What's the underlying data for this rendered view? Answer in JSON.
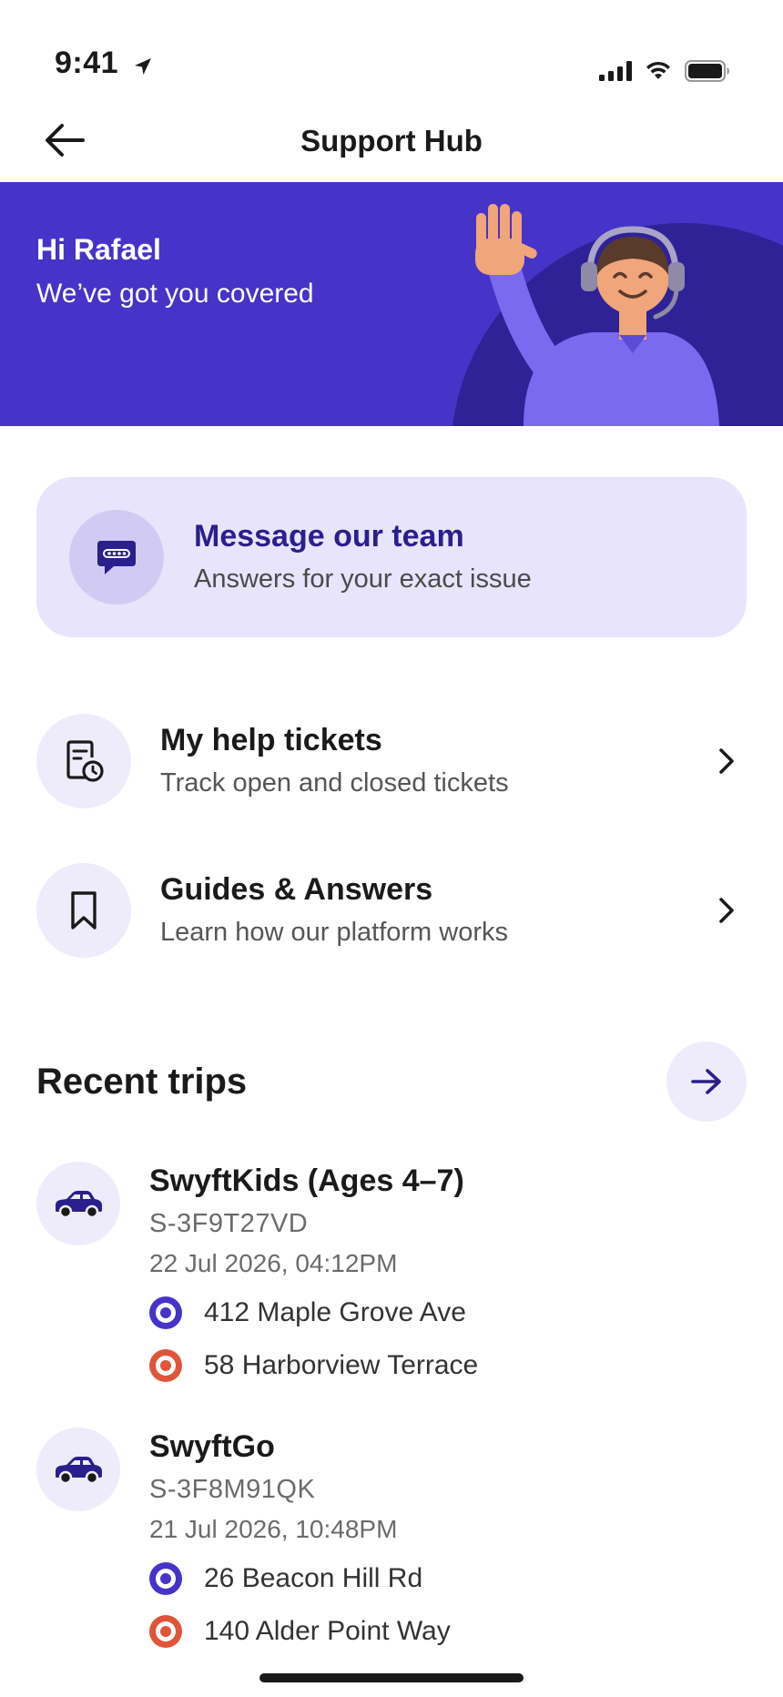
{
  "status_bar": {
    "time": "9:41"
  },
  "nav": {
    "title": "Support Hub"
  },
  "hero": {
    "greeting": "Hi Rafael",
    "subtitle": "We’ve got you covered"
  },
  "message_card": {
    "title": "Message our team",
    "subtitle": "Answers for your exact issue"
  },
  "menu": [
    {
      "title": "My help tickets",
      "subtitle": "Track open and closed tickets",
      "icon": "ticket-clock-icon"
    },
    {
      "title": "Guides & Answers",
      "subtitle": "Learn how our platform works",
      "icon": "bookmark-icon"
    }
  ],
  "recent_trips": {
    "title": "Recent trips",
    "trips": [
      {
        "name": "SwyftKids (Ages 4–7)",
        "code": "S-3F9T27VD",
        "datetime": "22 Jul 2026, 04:12PM",
        "pickup": "412 Maple Grove Ave",
        "dropoff": "58 Harborview Terrace"
      },
      {
        "name": "SwyftGo",
        "code": "S-3F8M91QK",
        "datetime": "21 Jul 2026, 10:48PM",
        "pickup": "26 Beacon Hill Rd",
        "dropoff": "140 Alder Point Way"
      }
    ]
  },
  "colors": {
    "brand": "#4633c8",
    "pickup": "#4633c8",
    "dropoff": "#e0553a",
    "card_bg": "#e7e4fb"
  }
}
